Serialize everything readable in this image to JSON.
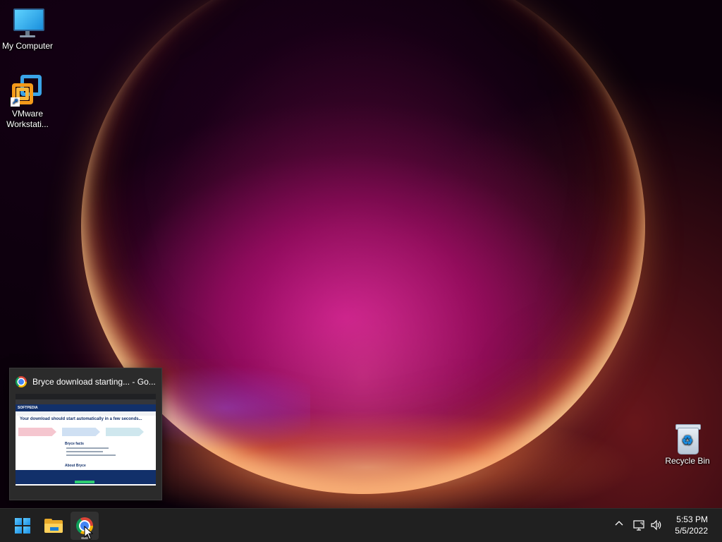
{
  "desktop": {
    "icons": [
      {
        "label": "My Computer",
        "icon": "computer-icon"
      },
      {
        "label": "VMware\nWorkstati...",
        "label_line1": "VMware",
        "label_line2": "Workstati...",
        "icon": "vmware-icon"
      },
      {
        "label": "Recycle Bin",
        "icon": "recycle-bin-icon"
      }
    ]
  },
  "preview": {
    "title": "Bryce download starting... - Go...",
    "icon": "chrome-icon",
    "page": {
      "site": "SOFTPEDIA",
      "heading": "Your download should start automatically in a few seconds...",
      "facts_heading": "Bryce facts",
      "about_heading": "About Bryce"
    }
  },
  "taskbar": {
    "buttons": [
      {
        "name": "start",
        "icon": "windows-icon"
      },
      {
        "name": "file-explorer",
        "icon": "folder-icon"
      },
      {
        "name": "chrome",
        "icon": "chrome-icon",
        "active": true
      }
    ],
    "tray": {
      "chevron": "^",
      "network_icon": "network-icon",
      "volume_icon": "volume-icon"
    },
    "clock": {
      "time": "5:53 PM",
      "date": "5/5/2022"
    }
  },
  "colors": {
    "taskbar_bg": "#202020",
    "accent_blue": "#1a8fe3",
    "preview_bg": "#2b2b2b"
  }
}
